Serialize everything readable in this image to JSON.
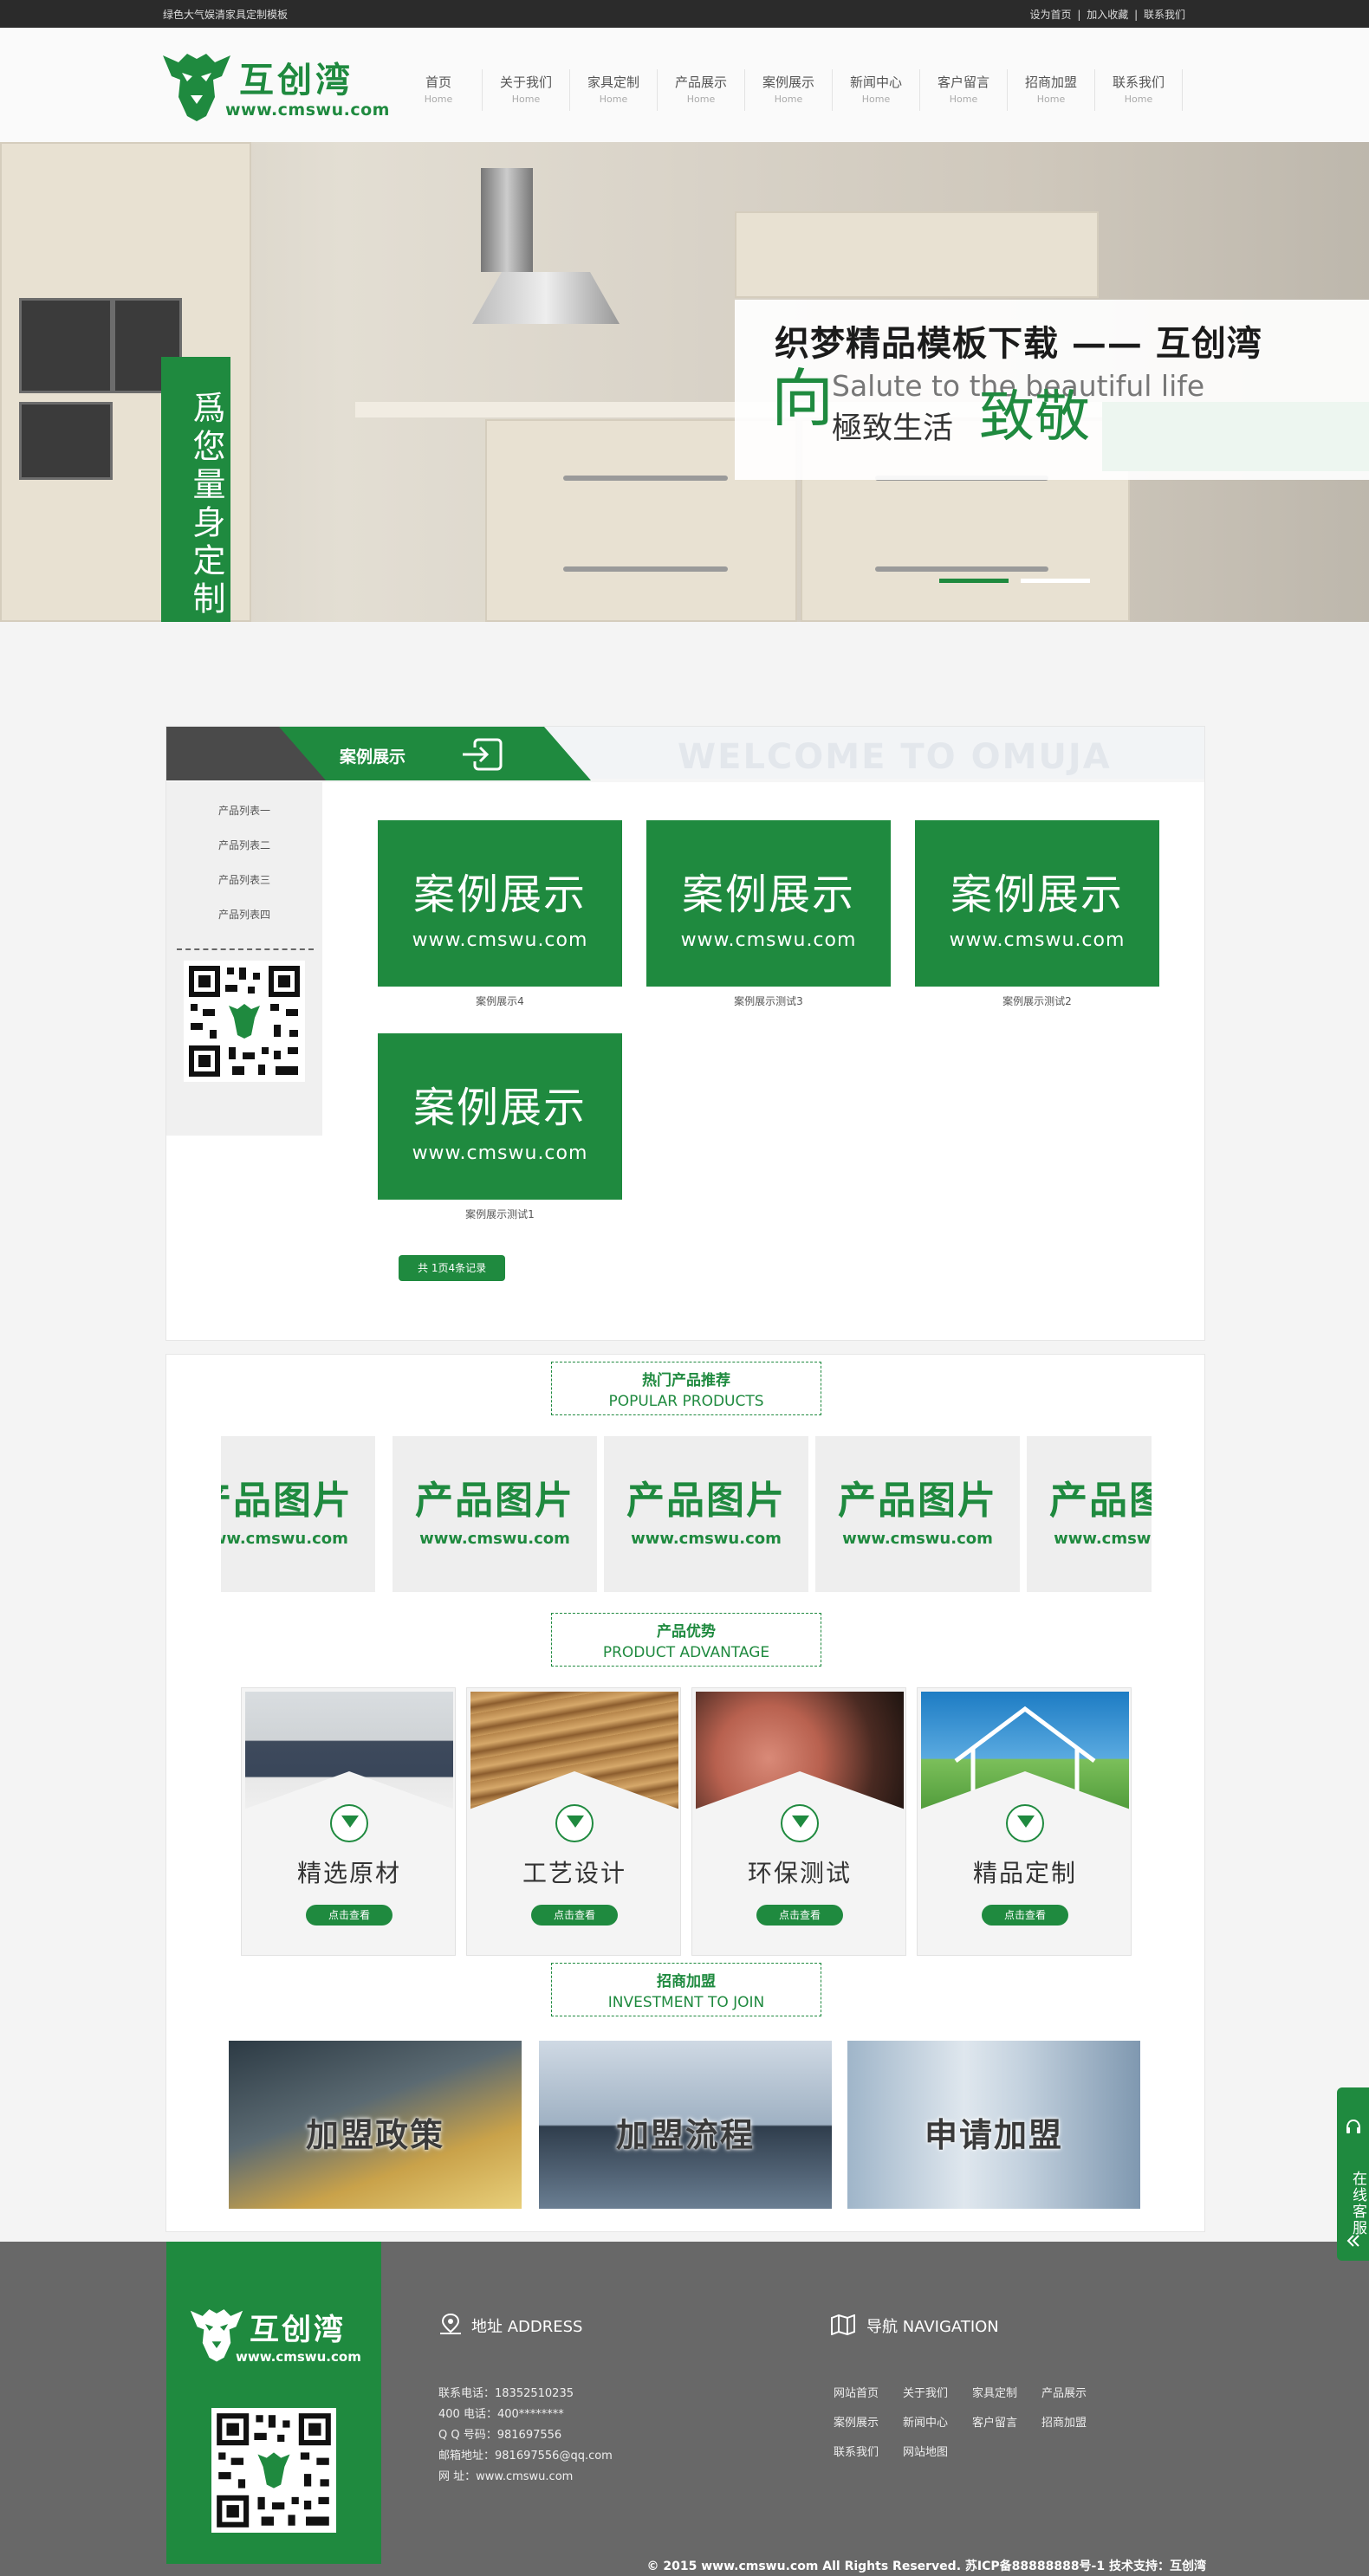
{
  "topbar": {
    "left_text": "绿色大气娱清家具定制模板",
    "links": [
      "设为首页",
      "加入收藏",
      "联系我们"
    ],
    "separator": "|"
  },
  "logo": {
    "title": "互创湾",
    "url": "www.cmswu.com"
  },
  "nav": [
    {
      "cn": "首页",
      "en": "Home"
    },
    {
      "cn": "关于我们",
      "en": "Home"
    },
    {
      "cn": "家具定制",
      "en": "Home"
    },
    {
      "cn": "产品展示",
      "en": "Home"
    },
    {
      "cn": "案例展示",
      "en": "Home"
    },
    {
      "cn": "新闻中心",
      "en": "Home"
    },
    {
      "cn": "客户留言",
      "en": "Home"
    },
    {
      "cn": "招商加盟",
      "en": "Home"
    },
    {
      "cn": "联系我们",
      "en": "Home"
    }
  ],
  "banner": {
    "vertical_text": "爲您量身定制",
    "headline": "织梦精品模板下载 —— 互创湾",
    "char_xiang": "向",
    "english": "Salute to the beautiful life",
    "subline": "極致生活",
    "char_zhijing": "致敬",
    "active_slide": 1,
    "slide_count": 2
  },
  "case": {
    "title": "案例展示",
    "watermark": "WELCOME TO OMUJA",
    "side_items": [
      "产品列表一",
      "产品列表二",
      "产品列表三",
      "产品列表四"
    ],
    "cards": [
      {
        "img_title": "案例展示",
        "img_url": "www.cmswu.com",
        "caption": "案例展示4"
      },
      {
        "img_title": "案例展示",
        "img_url": "www.cmswu.com",
        "caption": "案例展示测试3"
      },
      {
        "img_title": "案例展示",
        "img_url": "www.cmswu.com",
        "caption": "案例展示测试2"
      },
      {
        "img_title": "案例展示",
        "img_url": "www.cmswu.com",
        "caption": "案例展示测试1"
      }
    ],
    "pager": "共 1页4条记录"
  },
  "popular": {
    "title_cn": "热门产品推荐",
    "title_en": "POPULAR PRODUCTS",
    "products": [
      {
        "title": "产品图片",
        "url": "www.cmswu.com"
      },
      {
        "title": "产品图片",
        "url": "www.cmswu.com"
      },
      {
        "title": "产品图片",
        "url": "www.cmswu.com"
      },
      {
        "title": "产品图片",
        "url": "www.cmswu.com"
      },
      {
        "title": "产品图片",
        "url": "www.cmswu.com"
      }
    ]
  },
  "advantage": {
    "title_cn": "产品优势",
    "title_en": "PRODUCT ADVANTAGE",
    "items": [
      {
        "name": "精选原材",
        "button": "点击查看"
      },
      {
        "name": "工艺设计",
        "button": "点击查看"
      },
      {
        "name": "环保测试",
        "button": "点击查看"
      },
      {
        "name": "精品定制",
        "button": "点击查看"
      }
    ]
  },
  "investment": {
    "title_cn": "招商加盟",
    "title_en": "INVESTMENT TO JOIN",
    "items": [
      "加盟政策",
      "加盟流程",
      "申请加盟"
    ]
  },
  "footer": {
    "logo_title": "互创湾",
    "logo_url": "www.cmswu.com",
    "address_head": "地址  ADDRESS",
    "contact_lines": [
      "联系电话：18352510235",
      "400 电话：400********",
      "Q Q 号码：981697556",
      "邮箱地址：981697556@qq.com",
      "网      址：www.cmswu.com"
    ],
    "nav_head": "导航  NAVIGATION",
    "nav_links": [
      "网站首页",
      "关于我们",
      "家具定制",
      "产品展示",
      "案例展示",
      "新闻中心",
      "客户留言",
      "招商加盟",
      "联系我们",
      "网站地图"
    ],
    "copyright": "© 2015 www.cmswu.com All Rights Reserved. 苏ICP备88888888号-1 技术支持：互创湾"
  },
  "float_service": {
    "label": "在线客服"
  },
  "colors": {
    "brand_green": "#1f8a3f",
    "footer_gray": "#686868",
    "topbar_dark": "#2b2b2b"
  }
}
